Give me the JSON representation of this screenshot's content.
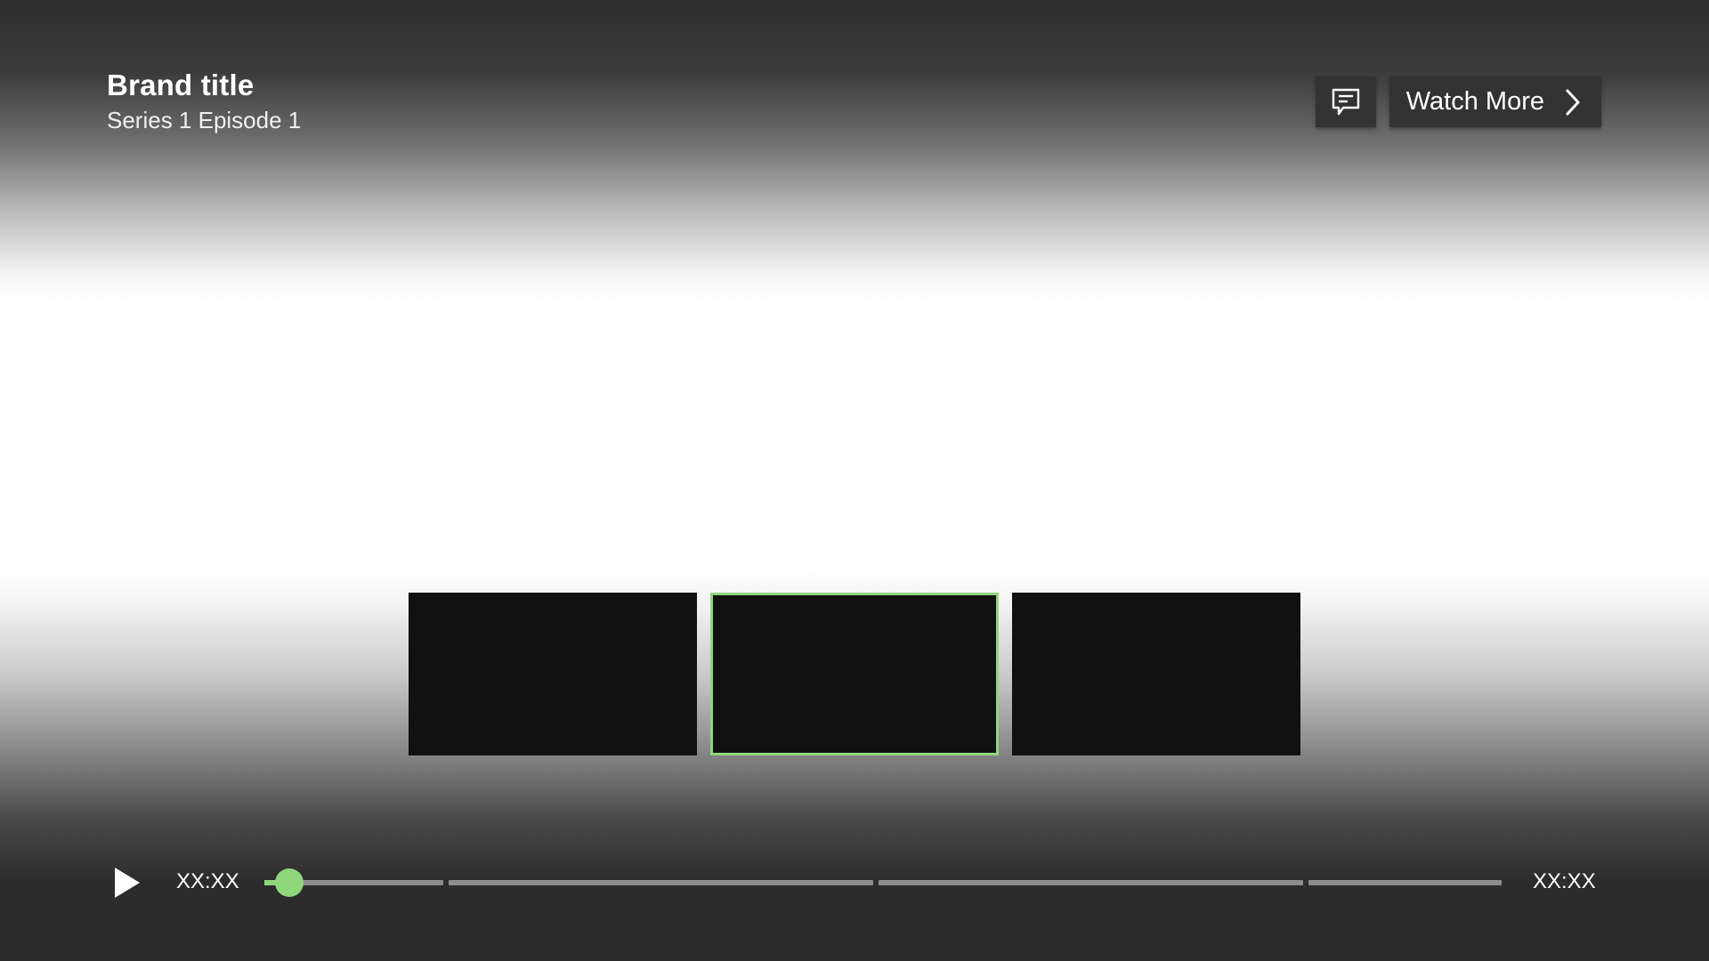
{
  "header": {
    "brand_title": "Brand title",
    "episode_title": "Series 1 Episode 1"
  },
  "actions": {
    "subtitles_icon": "subtitles-icon",
    "watch_more_label": "Watch More",
    "watch_more_icon": "chevron-right-icon"
  },
  "thumbnails": {
    "count": 3,
    "active_index": 1
  },
  "player": {
    "play_icon": "play-icon",
    "current_time": "XX:XX",
    "total_time": "XX:XX",
    "progress": 0.02,
    "chapter_count": 4,
    "accent_color": "#8fd67c",
    "track_color": "#8d8d8d"
  }
}
